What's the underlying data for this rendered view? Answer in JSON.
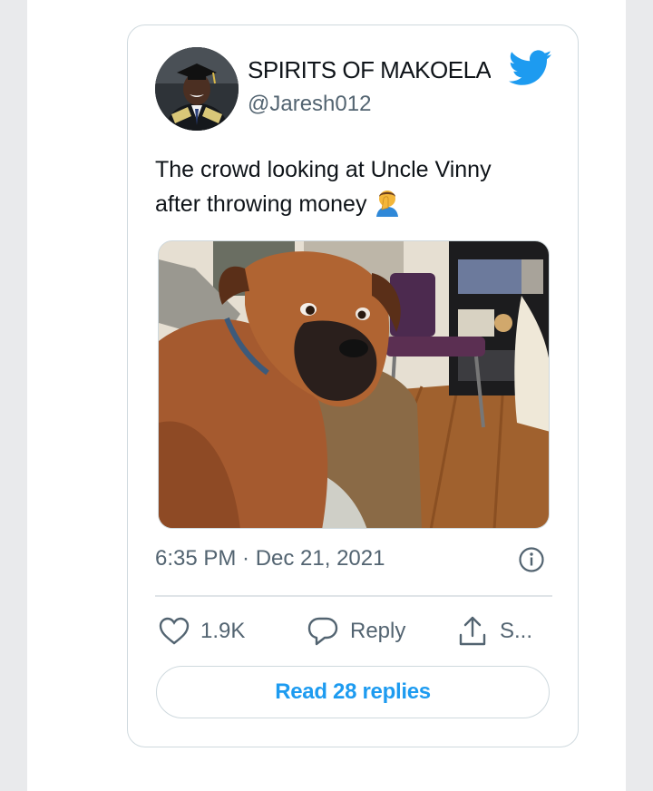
{
  "tweet": {
    "display_name": "SPIRITS OF MAKOELA",
    "handle": "@Jaresh012",
    "text_line1": "The crowd looking at Uncle Vinny",
    "text_line2": "after throwing money",
    "timestamp": "6:35 PM · Dec 21, 2021"
  },
  "actions": {
    "like_count": "1.9K",
    "reply_label": "Reply",
    "share_label": "S..."
  },
  "read_replies_label": "Read 28 replies",
  "colors": {
    "twitter_blue": "#1d9bf0",
    "muted_text": "#536471",
    "border": "#cfd9de"
  },
  "icons": [
    "twitter-bird-icon",
    "facepalm-emoji-icon",
    "info-icon",
    "heart-icon",
    "reply-bubble-icon",
    "share-icon"
  ]
}
